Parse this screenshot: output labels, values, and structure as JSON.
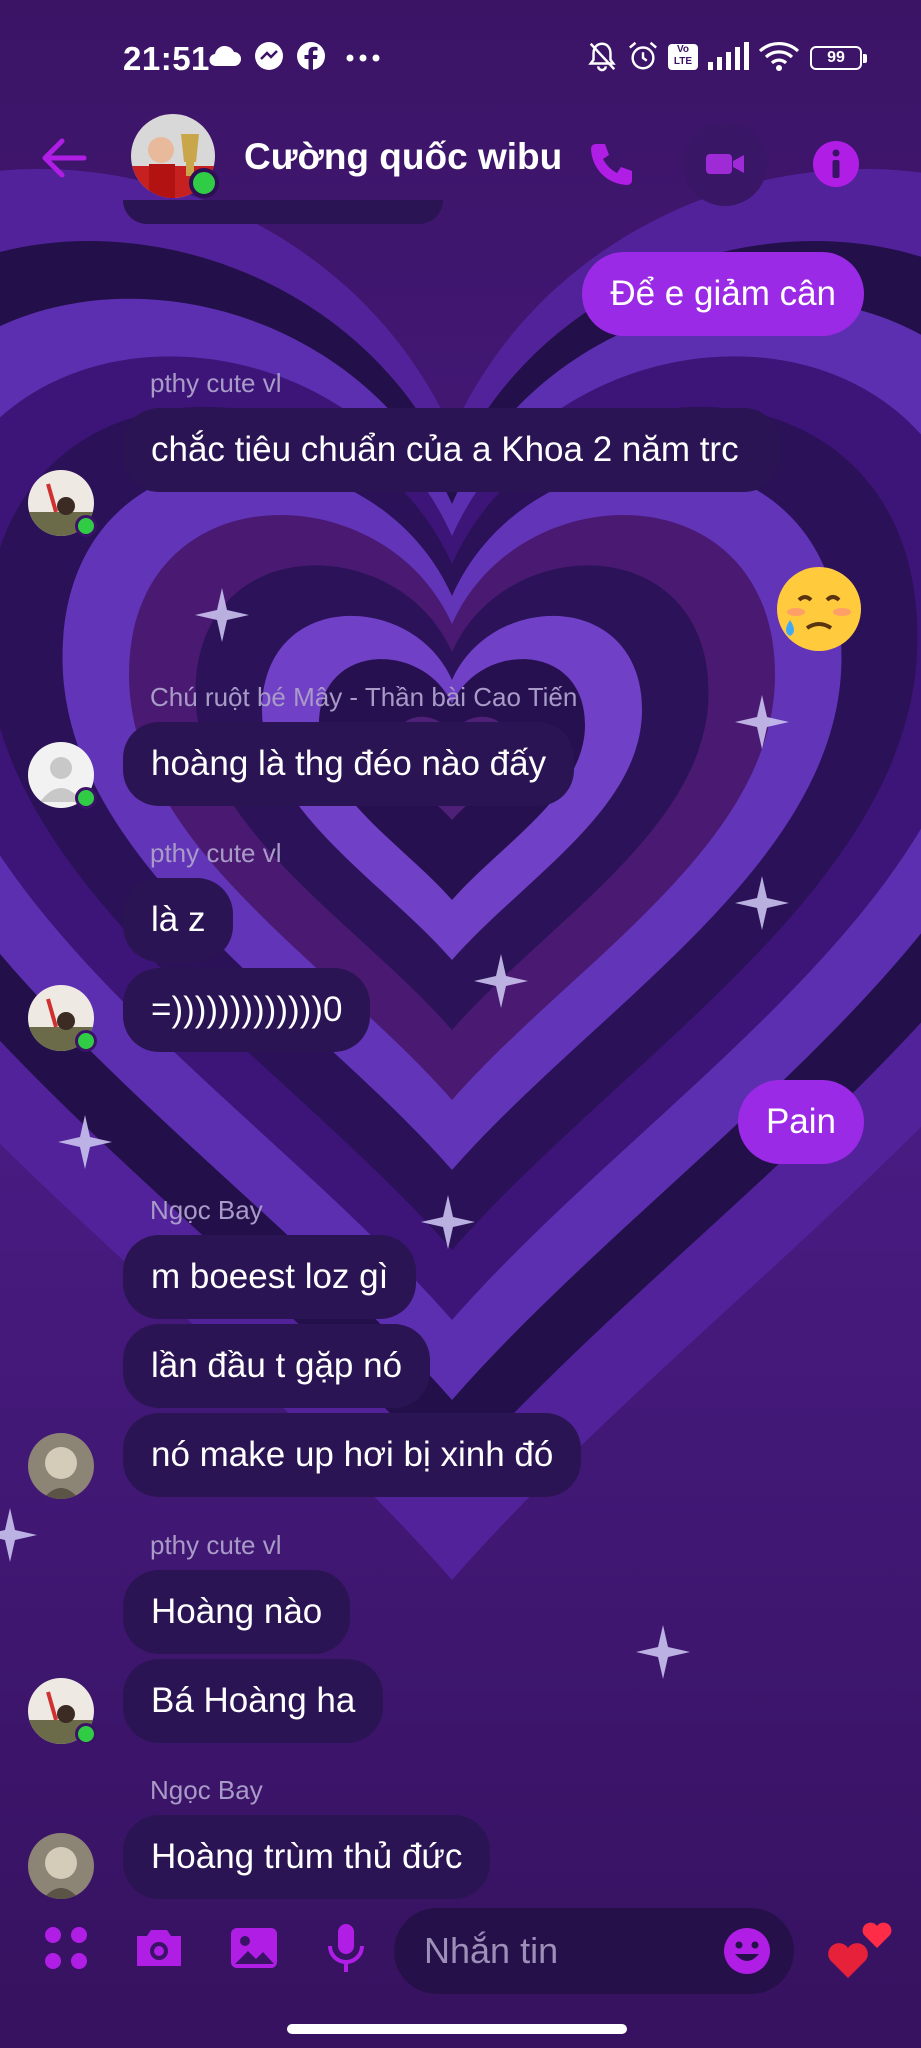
{
  "status_bar": {
    "time": "21:51",
    "volte": "Vo LTE",
    "battery": "99",
    "icons": [
      "cloud-icon",
      "messenger-icon",
      "facebook-icon",
      "more-dots-icon",
      "muted-bell-icon",
      "alarm-icon",
      "volte-icon",
      "signal-icon",
      "wifi-icon",
      "battery-icon"
    ]
  },
  "header": {
    "title": "Cường quốc wibu",
    "online": true,
    "icons": [
      "back-arrow-icon",
      "phone-icon",
      "video-icon",
      "info-icon"
    ]
  },
  "colors": {
    "accent": "#b01ee6",
    "outgoing_bubble": "#9b2ae6",
    "incoming_bubble": "#2b1453",
    "online": "#31cc46"
  },
  "messages": [
    {
      "dir": "out",
      "text": "Để e giảm cân"
    },
    {
      "dir": "in",
      "sender": "pthy cute vl",
      "text": "chắc tiêu chuẩn của a Khoa 2 năm trc"
    },
    {
      "dir": "out",
      "emoji": "crying-face-emoji",
      "text": "🥲"
    },
    {
      "dir": "in",
      "sender": "Chú ruột bé Mây - Thần bài Cao Tiến",
      "text": "hoàng là thg đéo nào đấy"
    },
    {
      "dir": "in",
      "sender": "pthy cute vl",
      "text": "là z"
    },
    {
      "dir": "in",
      "text": "=)))))))))))))0"
    },
    {
      "dir": "out",
      "text": "Pain"
    },
    {
      "dir": "in",
      "sender": "Ngọc Bay",
      "text": "m boeest loz gì"
    },
    {
      "dir": "in",
      "text": "lần đầu t gặp nó"
    },
    {
      "dir": "in",
      "text": "nó make up hơi bị xinh đó"
    },
    {
      "dir": "in",
      "sender": "pthy cute vl",
      "text": "Hoàng nào"
    },
    {
      "dir": "in",
      "text": "Bá Hoàng ha"
    },
    {
      "dir": "in",
      "sender": "Ngọc Bay",
      "text": "Hoàng trùm thủ đức"
    }
  ],
  "composer": {
    "placeholder": "Nhắn tin",
    "icons": [
      "apps-grid-icon",
      "camera-icon",
      "image-icon",
      "microphone-icon",
      "emoji-icon",
      "hearts-icon"
    ]
  }
}
